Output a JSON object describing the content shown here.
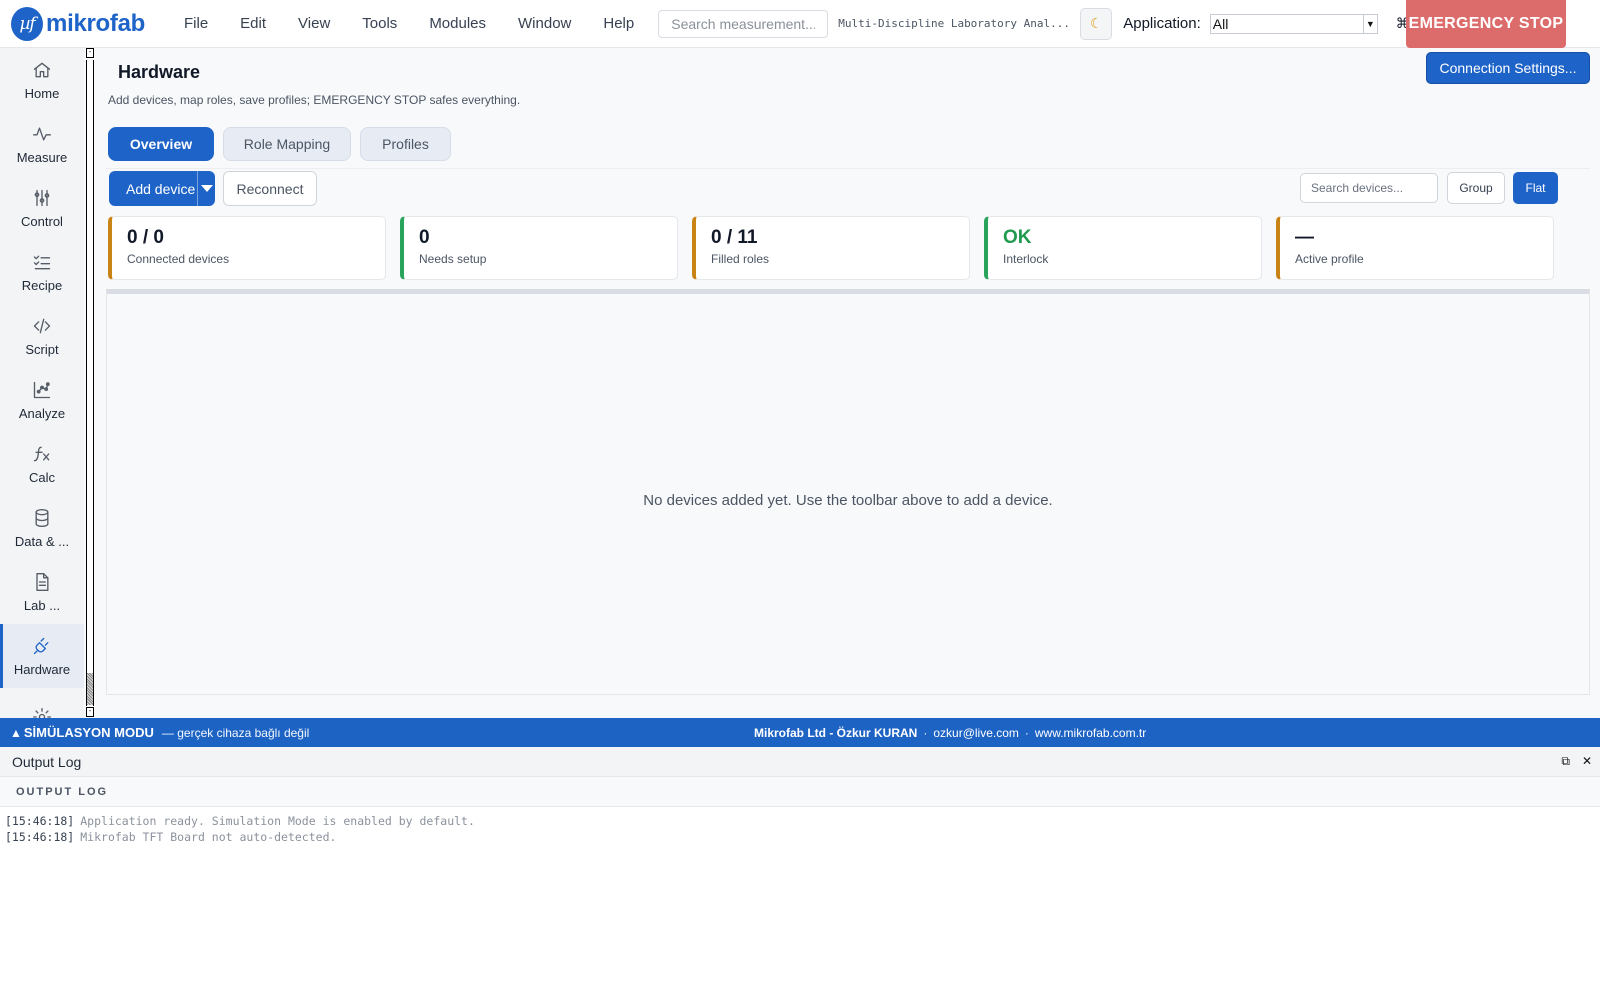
{
  "logo": {
    "mark": "µf",
    "name": "mikrofab"
  },
  "menu": [
    "File",
    "Edit",
    "View",
    "Tools",
    "Modules",
    "Window",
    "Help"
  ],
  "search": {
    "placeholder": "Search measurement..."
  },
  "app_title": "Multi-Discipline Laboratory Anal...",
  "application": {
    "label": "Application:",
    "value": "All"
  },
  "shortcut": "⌘K",
  "emergency_stop": "EMERGENCY STOP",
  "sidebar": {
    "items": [
      {
        "label": "Home",
        "icon": "home-icon"
      },
      {
        "label": "Measure",
        "icon": "wave-icon"
      },
      {
        "label": "Control",
        "icon": "sliders-icon"
      },
      {
        "label": "Recipe",
        "icon": "checklist-icon"
      },
      {
        "label": "Script",
        "icon": "code-icon"
      },
      {
        "label": "Analyze",
        "icon": "chart-icon"
      },
      {
        "label": "Calc",
        "icon": "function-icon"
      },
      {
        "label": "Data & ...",
        "icon": "database-icon"
      },
      {
        "label": "Lab ...",
        "icon": "document-icon"
      },
      {
        "label": "Hardware",
        "icon": "plug-icon",
        "active": true
      },
      {
        "label": "",
        "icon": "gear-icon"
      }
    ]
  },
  "page": {
    "title": "Hardware",
    "subtitle": "Add devices, map roles, save profiles; EMERGENCY STOP safes everything.",
    "connection_button": "Connection Settings..."
  },
  "tabs": [
    {
      "label": "Overview",
      "active": true
    },
    {
      "label": "Role Mapping",
      "active": false
    },
    {
      "label": "Profiles",
      "active": false
    }
  ],
  "toolbar": {
    "add_device": "Add device",
    "reconnect": "Reconnect",
    "search_placeholder": "Search devices...",
    "group": "Group",
    "flat": "Flat"
  },
  "stats": [
    {
      "value": "0 / 0",
      "caption": "Connected devices",
      "accent": "#c98416"
    },
    {
      "value": "0",
      "caption": "Needs setup",
      "accent": "#2aa45c"
    },
    {
      "value": "0 / 11",
      "caption": "Filled roles",
      "accent": "#c98416"
    },
    {
      "value": "OK",
      "caption": "Interlock",
      "accent": "#2aa45c"
    },
    {
      "value": "—",
      "caption": "Active profile",
      "accent": "#c98416"
    }
  ],
  "empty_message": "No devices added yet. Use the toolbar above to add a device.",
  "status_bar": {
    "mode": "SİMÜLASYON MODU",
    "note": "— gerçek cihaza bağlı değil",
    "company": "Mikrofab Ltd - Özkur KURAN",
    "email": "ozkur@live.com",
    "website": "www.mikrofab.com.tr",
    "separator": "·"
  },
  "output_log": {
    "title": "Output Log",
    "section": "OUTPUT LOG",
    "entries": [
      {
        "time": "[15:46:18]",
        "message": "Application ready. Simulation Mode is enabled by default."
      },
      {
        "time": "[15:46:18]",
        "message": "Mikrofab TFT Board not auto-detected."
      }
    ]
  },
  "colors": {
    "accent": "#1e63c8",
    "emergency": "#dc6c6c",
    "warning_accent": "#c98416",
    "ok_accent": "#2aa45c",
    "status_bar": "#1d63c4"
  }
}
